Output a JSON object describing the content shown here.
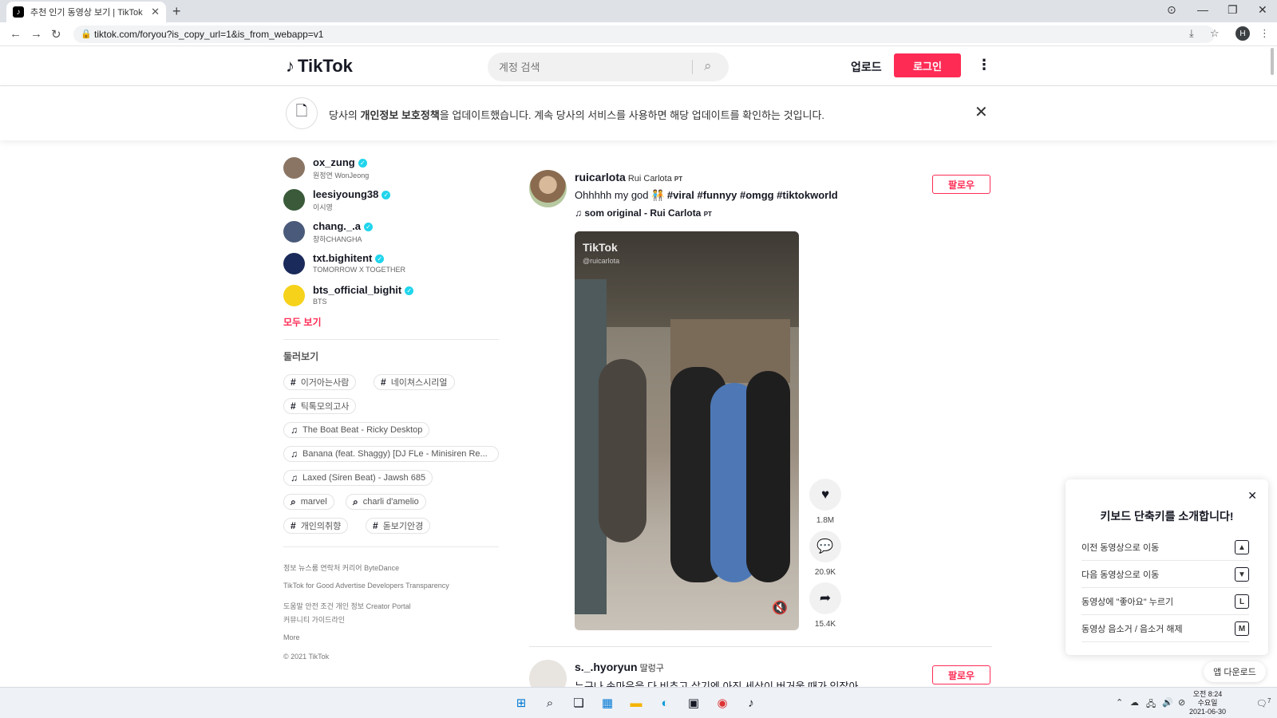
{
  "browser": {
    "tab_title": "추천 인기 동영상 보기 | TikTok",
    "url": "tiktok.com/foryou?is_copy_url=1&is_from_webapp=v1",
    "profile_initial": "H"
  },
  "header": {
    "logo": "TikTok",
    "search_placeholder": "계정 검색",
    "upload": "업로드",
    "login": "로그인"
  },
  "banner": {
    "pre": "당사의 ",
    "bold": "개인정보 보호정책",
    "post": "을 업데이트했습니다. 계속 당사의 서비스를 사용하면 해당 업데이트를 확인하는 것입니다."
  },
  "sidebar": {
    "accounts": [
      {
        "username": "ox_zung",
        "display": "원정연 WonJeong",
        "color": "#8a7564"
      },
      {
        "username": "leesiyoung38",
        "display": "이시영",
        "color": "#3a5a3a"
      },
      {
        "username": "chang._.a",
        "display": "창하CHANGHA",
        "color": "#4a5a7a"
      },
      {
        "username": "txt.bighitent",
        "display": "TOMORROW X TOGETHER",
        "color": "#1a2a5a"
      },
      {
        "username": "bts_official_bighit",
        "display": "BTS",
        "color": "#f6d21a"
      }
    ],
    "see_all": "모두 보기",
    "discover_title": "둘러보기",
    "tags": [
      {
        "icon": "#",
        "label": "이거아는사람"
      },
      {
        "icon": "#",
        "label": "네이쳐스시리얼"
      },
      {
        "icon": "#",
        "label": "틱톡모의고사"
      },
      {
        "icon": "♫",
        "label": "The Boat Beat - Ricky Desktop"
      },
      {
        "icon": "♫",
        "label": "Banana (feat. Shaggy) [DJ FLe - Minisiren Re..."
      },
      {
        "icon": "♫",
        "label": "Laxed (Siren Beat) - Jawsh 685"
      },
      {
        "icon": "⌕",
        "label": "marvel"
      },
      {
        "icon": "⌕",
        "label": "charli d'amelio"
      },
      {
        "icon": "#",
        "label": "개인의취향"
      },
      {
        "icon": "#",
        "label": "돋보기안경"
      }
    ],
    "footer": [
      "정보  뉴스룸  연락처  커리어  ByteDance",
      "TikTok for Good  Advertise  Developers  Transparency",
      "도움말  안전  조건  개인 정보  Creator Portal",
      "커뮤니티 가이드라인",
      "More",
      "© 2021 TikTok"
    ]
  },
  "post1": {
    "username": "ruicarlota",
    "nickname": "Rui Carlota",
    "flag": "PT",
    "desc_text": "Ohhhhh my god 🧑‍🤝‍🧑 ",
    "desc_tags": "#viral #funnyy #omgg #tiktokworld",
    "music": "som original - Rui Carlota",
    "follow": "팔로우",
    "watermark": "TikTok",
    "watermark_user": "@ruicarlota",
    "likes": "1.8M",
    "comments": "20.9K",
    "shares": "15.4K"
  },
  "post2": {
    "username": "s._.hyoryun",
    "nickname": "딸렁구",
    "desc": "누구나 속마음을 다 비추고 살기엔 아직 세상이 버거울 때가 있잖아",
    "follow": "팔로우"
  },
  "shortcuts": {
    "title": "키보드 단축키를 소개합니다!",
    "rows": [
      {
        "label": "이전 동영상으로 이동",
        "key": "▲"
      },
      {
        "label": "다음 동영상으로 이동",
        "key": "▼"
      },
      {
        "label": "동영상에 \"좋아요\" 누르기",
        "key": "L"
      },
      {
        "label": "동영상 음소거 / 음소거 해제",
        "key": "M"
      }
    ]
  },
  "app_download": "앱 다운로드",
  "taskbar": {
    "time": "오전 8:24",
    "day": "수요일",
    "date": "2021-06-30",
    "notif": "7"
  }
}
